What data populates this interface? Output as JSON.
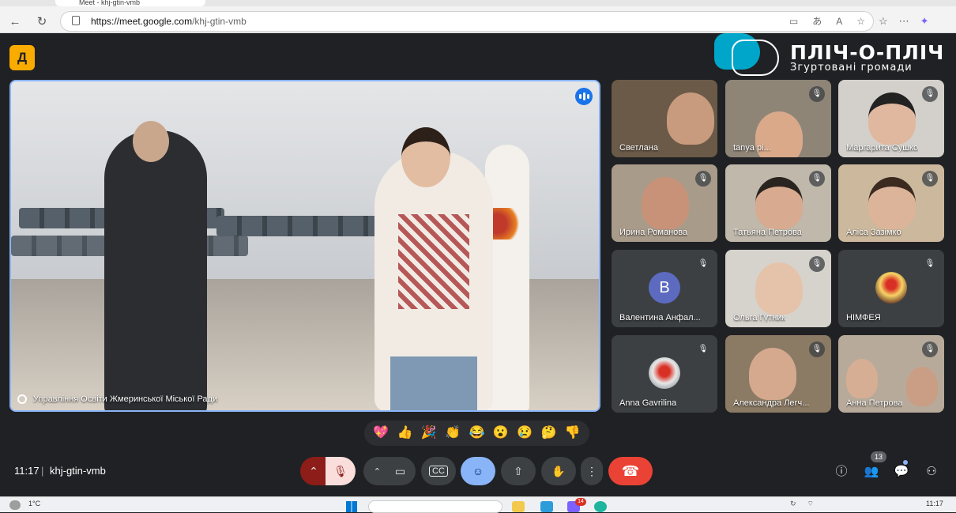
{
  "browser": {
    "tab_title": "Meet - khj-gtin-vmb",
    "url_host": "https://meet.google.com",
    "url_path": "/khj-gtin-vmb"
  },
  "brand": {
    "title": "ПЛІЧ-О-ПЛІЧ",
    "subtitle": "Згуртовані громади"
  },
  "main_video": {
    "label": "Управління Освіти Жмеринської Міської Ради"
  },
  "participants": [
    {
      "name": "Светлана"
    },
    {
      "name": "tanya pi..."
    },
    {
      "name": "Маргарита Сушко"
    },
    {
      "name": "Ирина Романова"
    },
    {
      "name": "Татьяна Петрова"
    },
    {
      "name": "Аліса Зазімко"
    },
    {
      "name": "Валентина Анфал...",
      "initial": "В"
    },
    {
      "name": "Ольга Гутник"
    },
    {
      "name": "НІМФЕЯ"
    },
    {
      "name": "Anna Gavrilina"
    },
    {
      "name": "Александра Легч..."
    },
    {
      "name": "Анна Петрова"
    }
  ],
  "reactions": [
    "💖",
    "👍",
    "🎉",
    "👏",
    "😂",
    "😮",
    "😢",
    "🤔",
    "👎"
  ],
  "bottom": {
    "time": "11:17",
    "separator": "|",
    "meeting_code": "khj-gtin-vmb",
    "people_count": "13"
  },
  "taskbar": {
    "weather": "1°C",
    "clock": "11:17",
    "badge": "14"
  }
}
